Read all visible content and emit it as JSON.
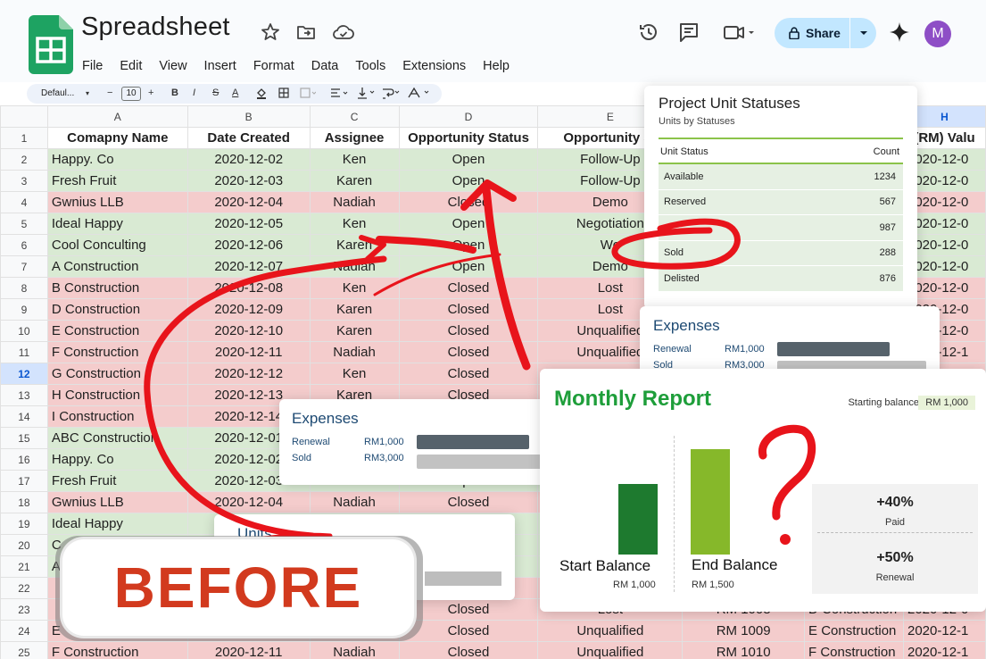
{
  "app": {
    "title": "Spreadsheet",
    "menu": [
      "File",
      "Edit",
      "View",
      "Insert",
      "Format",
      "Data",
      "Tools",
      "Extensions",
      "Help"
    ],
    "share_label": "Share",
    "avatar_initial": "M",
    "accent": "#c2e7ff",
    "logo_color": "#1ea362"
  },
  "toolbar": {
    "font": "Defaul...",
    "font_size": "10",
    "minus": "−",
    "plus": "+",
    "bold": "B",
    "italic": "I",
    "strike": "S",
    "text_color": "A"
  },
  "grid": {
    "columns": [
      "A",
      "B",
      "C",
      "D",
      "E",
      "",
      "",
      "H"
    ],
    "header_row": [
      "Comapny Name",
      "Date Created",
      "Assignee",
      "Opportunity Status",
      "Opportunity St",
      "",
      "",
      "(RM) Valu"
    ],
    "selected_row": "12",
    "status_colors": {
      "green": "#d9ead3",
      "red": "#f4cccc"
    },
    "rows": [
      {
        "n": "2",
        "st": "green",
        "a": "Happy. Co",
        "b": "2020-12-02",
        "c": "Ken",
        "d": "Open",
        "e": "Follow-Up",
        "f": "",
        "g": "",
        "h": "2020-12-0"
      },
      {
        "n": "3",
        "st": "green",
        "a": "Fresh Fruit",
        "b": "2020-12-03",
        "c": "Karen",
        "d": "Open",
        "e": "Follow-Up",
        "f": "",
        "g": "",
        "h": "2020-12-0"
      },
      {
        "n": "4",
        "st": "red",
        "a": "Gwnius LLB",
        "b": "2020-12-04",
        "c": "Nadiah",
        "d": "Closed",
        "e": "Demo",
        "f": "",
        "g": "",
        "h": "2020-12-0"
      },
      {
        "n": "5",
        "st": "green",
        "a": "Ideal Happy",
        "b": "2020-12-05",
        "c": "Ken",
        "d": "Open",
        "e": "Negotiation",
        "f": "",
        "g": "",
        "h": "2020-12-0"
      },
      {
        "n": "6",
        "st": "green",
        "a": "Cool Conculting",
        "b": "2020-12-06",
        "c": "Karen",
        "d": "Open",
        "e": "Wo",
        "f": "",
        "g": "",
        "h": "2020-12-0"
      },
      {
        "n": "7",
        "st": "green",
        "a": "A Construction",
        "b": "2020-12-07",
        "c": "Nadiah",
        "d": "Open",
        "e": "Demo",
        "f": "",
        "g": "",
        "h": "2020-12-0"
      },
      {
        "n": "8",
        "st": "red",
        "a": "B Construction",
        "b": "2020-12-08",
        "c": "Ken",
        "d": "Closed",
        "e": "Lost",
        "f": "",
        "g": "",
        "h": "2020-12-0"
      },
      {
        "n": "9",
        "st": "red",
        "a": "D Construction",
        "b": "2020-12-09",
        "c": "Karen",
        "d": "Closed",
        "e": "Lost",
        "f": "",
        "g": "",
        "h": "2020-12-0"
      },
      {
        "n": "10",
        "st": "red",
        "a": "E Construction",
        "b": "2020-12-10",
        "c": "Karen",
        "d": "Closed",
        "e": "Unqualified",
        "f": "",
        "g": "",
        "h": "2020-12-0"
      },
      {
        "n": "11",
        "st": "red",
        "a": "F Construction",
        "b": "2020-12-11",
        "c": "Nadiah",
        "d": "Closed",
        "e": "Unqualified",
        "f": "",
        "g": "",
        "h": "2020-12-1"
      },
      {
        "n": "12",
        "st": "red",
        "a": "G Construction",
        "b": "2020-12-12",
        "c": "Ken",
        "d": "Closed",
        "e": "",
        "f": "",
        "g": "",
        "h": ""
      },
      {
        "n": "13",
        "st": "red",
        "a": "H Construction",
        "b": "2020-12-13",
        "c": "Karen",
        "d": "Closed",
        "e": "",
        "f": "",
        "g": "",
        "h": ""
      },
      {
        "n": "14",
        "st": "red",
        "a": "I Construction",
        "b": "2020-12-14",
        "c": "",
        "d": "",
        "e": "",
        "f": "",
        "g": "",
        "h": ""
      },
      {
        "n": "15",
        "st": "green",
        "a": "ABC Construction",
        "b": "2020-12-01",
        "c": "",
        "d": "",
        "e": "",
        "f": "",
        "g": "",
        "h": ""
      },
      {
        "n": "16",
        "st": "green",
        "a": "Happy. Co",
        "b": "2020-12-02",
        "c": "",
        "d": "",
        "e": "",
        "f": "",
        "g": "",
        "h": ""
      },
      {
        "n": "17",
        "st": "green",
        "a": "Fresh Fruit",
        "b": "2020-12-03",
        "c": "Karen",
        "d": "Open",
        "e": "",
        "f": "",
        "g": "",
        "h": ""
      },
      {
        "n": "18",
        "st": "red",
        "a": "Gwnius LLB",
        "b": "2020-12-04",
        "c": "Nadiah",
        "d": "Closed",
        "e": "",
        "f": "",
        "g": "",
        "h": ""
      },
      {
        "n": "19",
        "st": "green",
        "a": "Ideal Happy",
        "b": "",
        "c": "",
        "d": "",
        "e": "",
        "f": "",
        "g": "",
        "h": ""
      },
      {
        "n": "20",
        "st": "green",
        "a": "C",
        "b": "",
        "c": "",
        "d": "",
        "e": "",
        "f": "",
        "g": "",
        "h": ""
      },
      {
        "n": "21",
        "st": "green",
        "a": "A",
        "b": "",
        "c": "",
        "d": "",
        "e": "",
        "f": "",
        "g": "",
        "h": ""
      },
      {
        "n": "22",
        "st": "red",
        "a": "",
        "b": "",
        "c": "",
        "d": "",
        "e": "",
        "f": "",
        "g": "",
        "h": ""
      },
      {
        "n": "23",
        "st": "red",
        "a": "",
        "b": "",
        "c": "",
        "d": "Closed",
        "e": "Lost",
        "f": "RM 1008",
        "g": "D Construction",
        "h": "2020-12-0"
      },
      {
        "n": "24",
        "st": "red",
        "a": "E",
        "b": "",
        "c": "",
        "d": "Closed",
        "e": "Unqualified",
        "f": "RM 1009",
        "g": "E Construction",
        "h": "2020-12-1"
      },
      {
        "n": "25",
        "st": "red",
        "a": "F Construction",
        "b": "2020-12-11",
        "c": "Nadiah",
        "d": "Closed",
        "e": "Unqualified",
        "f": "RM 1010",
        "g": "F Construction",
        "h": "2020-12-1"
      }
    ]
  },
  "unit_statuses": {
    "title": "Project Unit Statuses",
    "subtitle": "Units by Statuses",
    "col_status": "Unit Status",
    "col_count": "Count",
    "rows": [
      {
        "status": "Available",
        "count": "1234"
      },
      {
        "status": "Reserved",
        "count": "567"
      },
      {
        "status": "",
        "count": "987"
      },
      {
        "status": "Sold",
        "count": "288"
      },
      {
        "status": "Delisted",
        "count": "876"
      }
    ]
  },
  "expenses_right": {
    "title": "Expenses",
    "rows": [
      {
        "label": "Renewal",
        "amount": "RM1,000"
      },
      {
        "label": "Sold",
        "amount": "RM3,000"
      }
    ]
  },
  "expenses_center": {
    "title": "Expenses",
    "rows": [
      {
        "label": "Renewal",
        "amount": "RM1,000"
      },
      {
        "label": "Sold",
        "amount": "RM3,000"
      }
    ]
  },
  "monthly_report": {
    "title": "Monthly Report",
    "starting_balance_label": "Starting balance:",
    "starting_balance_value": "RM 1,000",
    "chart_data": {
      "type": "bar",
      "categories": [
        "Start Balance",
        "End Balance"
      ],
      "values": [
        1000,
        1500
      ],
      "value_labels": [
        "RM 1,000",
        "RM 1,500"
      ],
      "colors": [
        "#1e7a2f",
        "#86b82a"
      ]
    },
    "stats": [
      {
        "value": "+40%",
        "label": "Paid"
      },
      {
        "value": "+50%",
        "label": "Renewal"
      }
    ]
  },
  "units_card": {
    "title": "Units"
  },
  "badge": {
    "text": "BEFORE",
    "color": "#d23a1e"
  },
  "scribble_color": "#e8141b"
}
